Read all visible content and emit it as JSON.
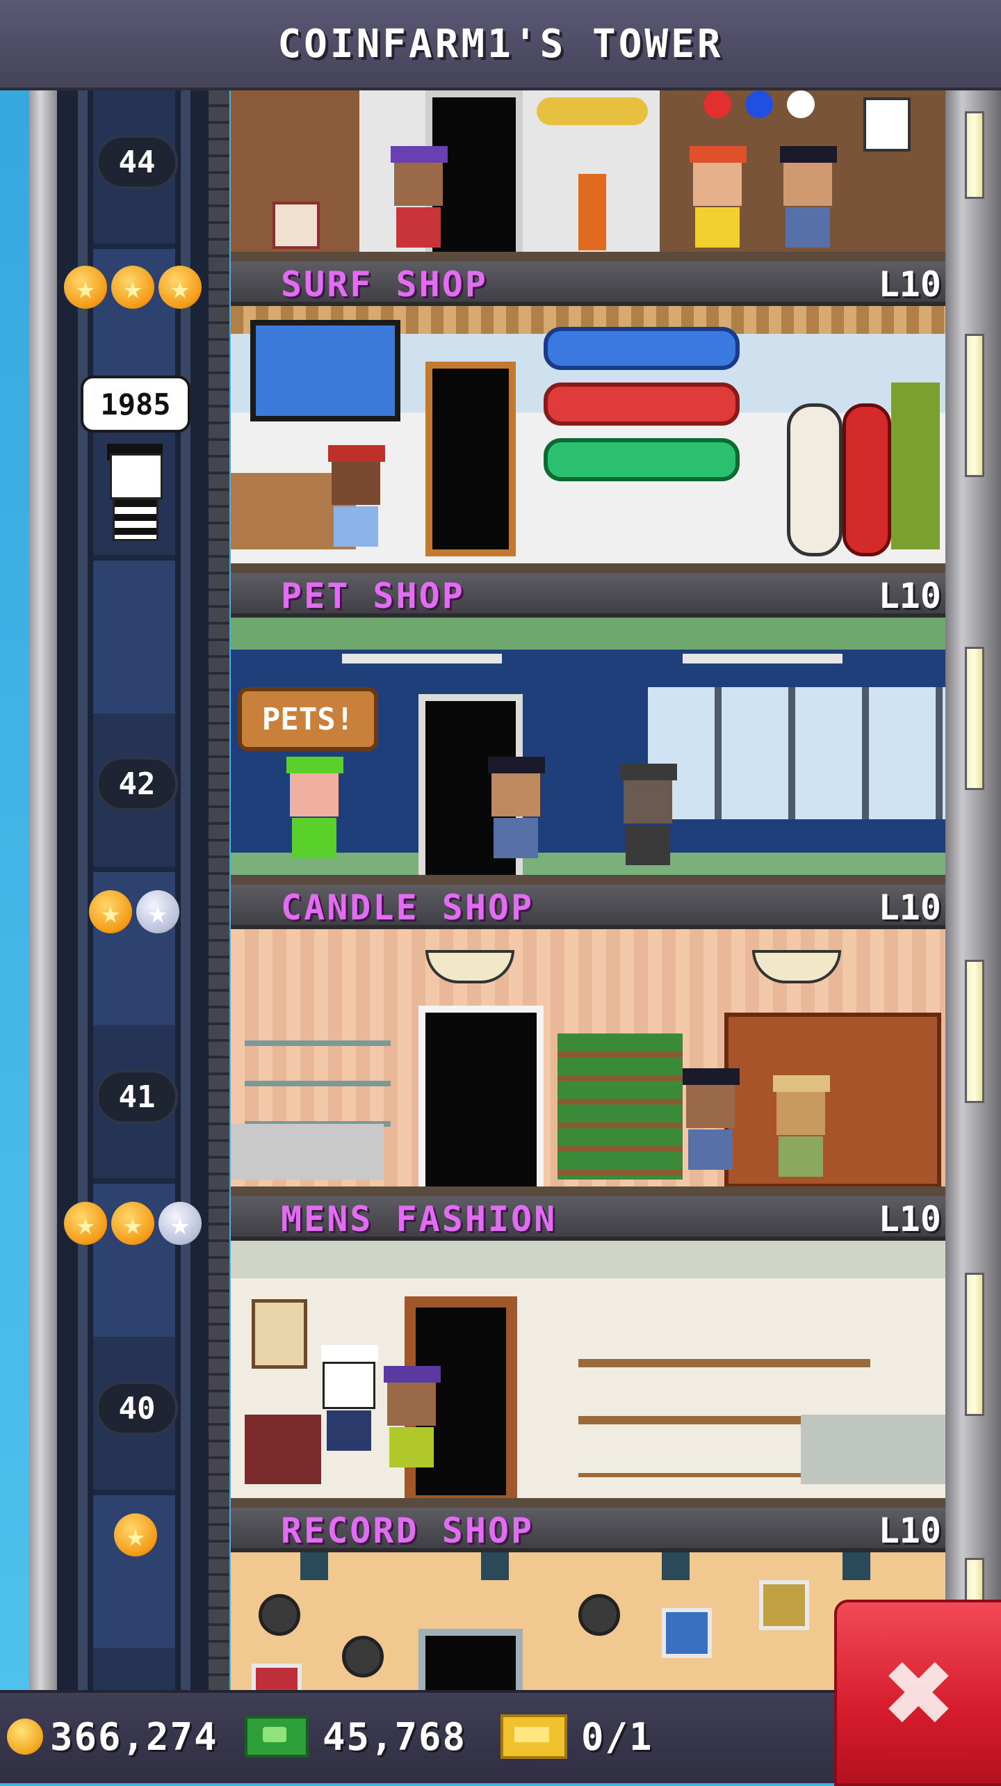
{
  "header": {
    "title": "COINFARM1'S TOWER"
  },
  "elevator": {
    "bubble_text": "1985"
  },
  "floor_numbers": [
    "44",
    "42",
    "41",
    "40"
  ],
  "floors": [
    {
      "name": "SURF SHOP",
      "level": "L10",
      "stars": [
        "gold",
        "gold",
        "gold"
      ]
    },
    {
      "name": "PET SHOP",
      "level": "L10",
      "stars": []
    },
    {
      "name": "CANDLE SHOP",
      "level": "L10",
      "stars": [
        "gold",
        "silver"
      ]
    },
    {
      "name": "MENS FASHION",
      "level": "L10",
      "stars": [
        "gold",
        "gold",
        "silver"
      ]
    },
    {
      "name": "RECORD SHOP",
      "level": "L10",
      "stars": [
        "gold"
      ]
    }
  ],
  "signs": {
    "pets": "PETS!"
  },
  "footer": {
    "coins": "366,274",
    "bux": "45,768",
    "vip": "0/1"
  },
  "icons": {
    "coin": "coin-icon",
    "bux": "tower-bux-icon",
    "vip": "vip-ticket-icon",
    "close": "close-icon",
    "star_gold": "gold-star-icon",
    "star_silver": "silver-star-icon"
  },
  "colors": {
    "floor_name": "#e26cf2",
    "close_button": "#d51c2c"
  }
}
